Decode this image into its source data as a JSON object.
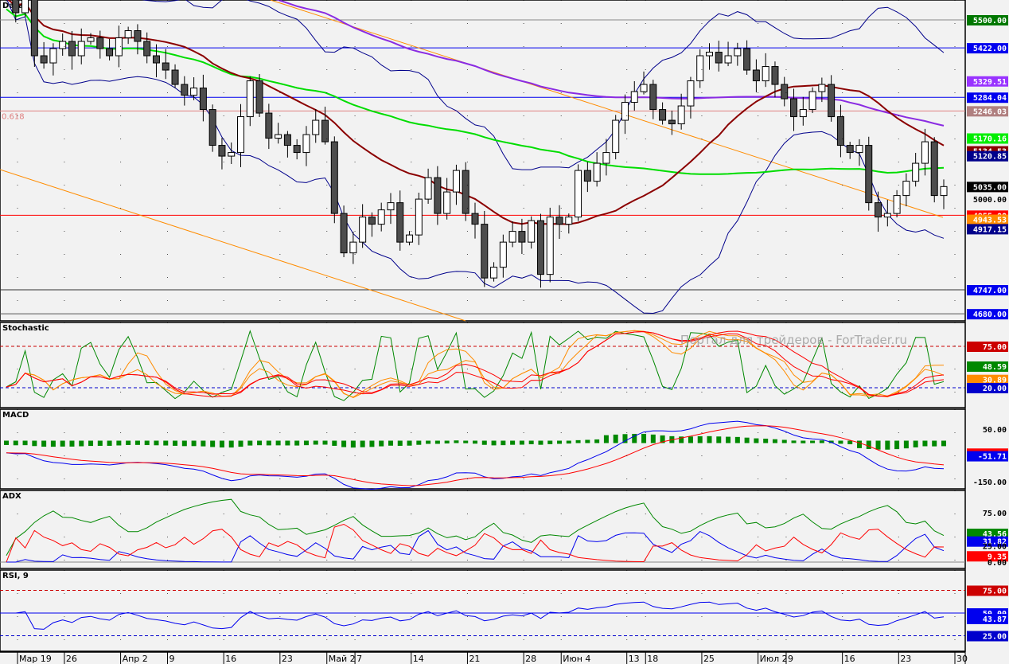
{
  "panels": {
    "main": "Data",
    "stochastic": "Stochastic",
    "macd": "MACD",
    "adx": "ADX",
    "rsi": "RSI, 9"
  },
  "watermark": "Портал для трейдеров - ForTrader.ru",
  "fib_label": "0.618",
  "colors": {
    "background": "#f2f2f2",
    "bull": "#ffffff",
    "bear": "#4d4d4d",
    "sma_fast": "#8b0000",
    "sma_mid": "#00dd00",
    "sma_slow": "#8a2be2",
    "bollinger": "#00008b",
    "trend": "#ff8c00"
  },
  "chart_data": {
    "type": "candlestick",
    "x_ticks": [
      "Мар 19",
      "26",
      "Апр 2",
      "9",
      "16",
      "23",
      "Май 2",
      "7",
      "14",
      "21",
      "28",
      "Июн 4",
      "13",
      "18",
      "25",
      "Июл 2",
      "9",
      "16",
      "23",
      "30"
    ],
    "x_tick_bars": [
      1,
      6,
      12,
      17,
      23,
      29,
      34,
      37,
      43,
      49,
      55,
      59,
      66,
      68,
      74,
      80,
      83,
      89,
      95,
      101
    ],
    "closes": [
      5560,
      5520,
      5560,
      5400,
      5380,
      5420,
      5440,
      5400,
      5440,
      5450,
      5420,
      5400,
      5450,
      5470,
      5440,
      5400,
      5380,
      5360,
      5320,
      5290,
      5310,
      5250,
      5150,
      5120,
      5130,
      5230,
      5330,
      5240,
      5170,
      5180,
      5150,
      5130,
      5180,
      5220,
      5160,
      4960,
      4850,
      4880,
      4950,
      4930,
      4970,
      4990,
      4880,
      4900,
      5000,
      5060,
      4960,
      5020,
      5080,
      4960,
      4930,
      4780,
      4810,
      4880,
      4910,
      4880,
      4940,
      4790,
      4950,
      4930,
      4950,
      5080,
      5050,
      5100,
      5130,
      5220,
      5270,
      5300,
      5320,
      5250,
      5220,
      5210,
      5260,
      5330,
      5400,
      5410,
      5380,
      5400,
      5420,
      5360,
      5330,
      5370,
      5320,
      5280,
      5230,
      5250,
      5300,
      5320,
      5230,
      5150,
      5130,
      5150,
      4990,
      4950,
      4960,
      5010,
      5050,
      5100,
      5160,
      5010,
      5035
    ],
    "price_range": [
      4650,
      5560
    ],
    "levels": [
      {
        "value": 5500.0,
        "label": "5500.00",
        "color": "#007700",
        "line": "#888888"
      },
      {
        "value": 5422.0,
        "label": "5422.00",
        "color": "#0000ee",
        "line": "#0000ee"
      },
      {
        "value": 5329.51,
        "label": "5329.51",
        "color": "#9933ff",
        "line": null
      },
      {
        "value": 5284.04,
        "label": "5284.04",
        "color": "#0000ee",
        "line": "#0000ee"
      },
      {
        "value": 5246.03,
        "label": "5246.03",
        "color": "#b08080",
        "line": "#e08080"
      },
      {
        "value": 5170.16,
        "label": "5170.16",
        "color": "#00ee00",
        "line": null
      },
      {
        "value": 5134.53,
        "label": "5134.53",
        "color": "#8b0000",
        "line": null
      },
      {
        "value": 5120.85,
        "label": "5120.85",
        "color": "#00008b",
        "line": null
      },
      {
        "value": 5035.0,
        "label": "5035.00",
        "color": "#000000",
        "line": null
      },
      {
        "value": 5000.0,
        "label": "5000.00",
        "color": null,
        "line": null
      },
      {
        "value": 4955.0,
        "label": "4955.00",
        "color": "#ff0000",
        "line": "#ff0000"
      },
      {
        "value": 4943.53,
        "label": "4943.53",
        "color": "#ff8c00",
        "line": null
      },
      {
        "value": 4917.15,
        "label": "4917.15",
        "color": "#00008b",
        "line": null
      },
      {
        "value": 4747.0,
        "label": "4747.00",
        "color": "#0000ee",
        "line": "#333333"
      },
      {
        "value": 4680.0,
        "label": "4680.00",
        "color": "#0000ee",
        "line": "#555555"
      }
    ],
    "stochastic": {
      "range": [
        0,
        100
      ],
      "levels": [
        75,
        20
      ],
      "labels": [
        {
          "value": 75,
          "label": "75.00",
          "color": "#cc0000"
        },
        {
          "value": 48.59,
          "label": "48.59",
          "color": "#008800"
        },
        {
          "value": 30.89,
          "label": "30.89",
          "color": "#ff8c00"
        },
        {
          "value": 20,
          "label": "20.00",
          "color": "#0000cc"
        }
      ]
    },
    "macd": {
      "ticks": [
        {
          "value": 50,
          "label": "50.00"
        },
        {
          "value": -150,
          "label": "-150.00"
        }
      ],
      "labels": [
        {
          "value": -41.74,
          "label": "-41.74",
          "color": "#ff0000"
        },
        {
          "value": -51.71,
          "label": "-51.71",
          "color": "#0000ee"
        }
      ]
    },
    "adx": {
      "ticks": [
        {
          "value": 75,
          "label": "75.00"
        },
        {
          "value": 25,
          "label": "25.00"
        },
        {
          "value": 0,
          "label": "0.00"
        }
      ],
      "labels": [
        {
          "value": 43.56,
          "label": "43.56",
          "color": "#008800"
        },
        {
          "value": 31.82,
          "label": "31.82",
          "color": "#0000ee"
        },
        {
          "value": 9.35,
          "label": "9.35",
          "color": "#ff0000"
        }
      ]
    },
    "rsi": {
      "period": 9,
      "levels": [
        75,
        50,
        25
      ],
      "labels": [
        {
          "value": 75,
          "label": "75.00",
          "color": "#cc0000"
        },
        {
          "value": 50,
          "label": "50.00",
          "color": "#0000ee"
        },
        {
          "value": 43.87,
          "label": "43.87",
          "color": "#0000ee"
        },
        {
          "value": 25,
          "label": "25.00",
          "color": "#0000cc"
        }
      ]
    }
  }
}
